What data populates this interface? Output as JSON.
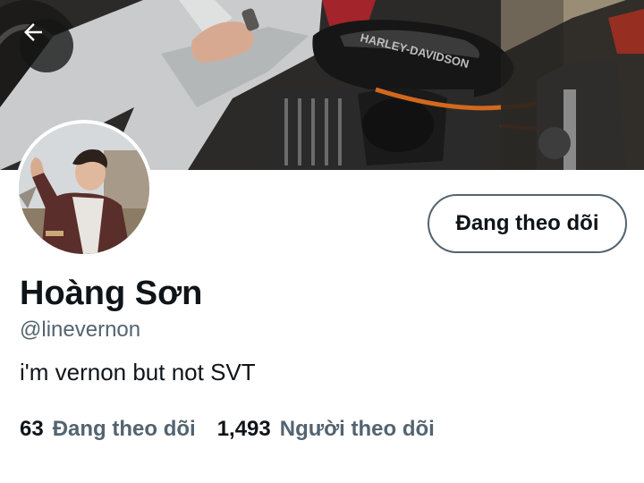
{
  "header": {
    "back_icon": "arrow-left-icon"
  },
  "profile": {
    "display_name": "Hoàng Sơn",
    "handle": "@linevernon",
    "bio": "i'm vernon but not SVT",
    "follow_button_label": "Đang theo dõi"
  },
  "stats": {
    "following": {
      "count": "63",
      "label": "Đang theo dõi"
    },
    "followers": {
      "count": "1,493",
      "label": "Người theo dõi"
    }
  },
  "banner": {
    "logo_text": "HARLEY-DAVIDSON"
  },
  "colors": {
    "text_primary": "#0f1419",
    "text_secondary": "#536471",
    "button_border": "#536471",
    "background": "#ffffff"
  }
}
